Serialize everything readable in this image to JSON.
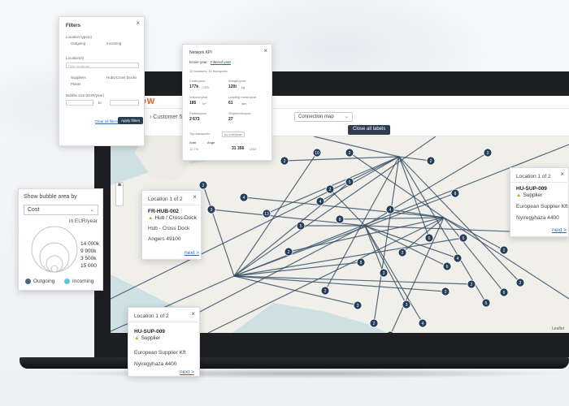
{
  "app": {
    "brand": "OW",
    "breadcrumb": "Customer 5",
    "view_select": "Connection map",
    "close_labels_button": "Close all labels",
    "map_attribution": "Leaflet"
  },
  "filters_panel": {
    "title": "Filters",
    "section_location_types": "Location type(s)",
    "check_outgoing": "Outgoing",
    "check_incoming": "Incoming",
    "locations_label": "Location(s)",
    "locations_placeholder": "Filter locations...",
    "check_suppliers": "Suppliers",
    "check_hubs": "Hubs/Cross Docks",
    "check_plants": "Plants",
    "bubble_size_label": "Bubble size (EUR/year)",
    "range_to": "to",
    "clear_label": "Clear all filters",
    "apply_label": "Apply filters"
  },
  "kpi_panel": {
    "title": "Network KPI",
    "tab_entire": "Entire year",
    "tab_filtered": "Filtered year",
    "summary": "22 locations, 11 transports",
    "cells": [
      {
        "label": "Costs/year",
        "value": "177k",
        "unit": "USD"
      },
      {
        "label": "Weight/year",
        "value": "120t",
        "unit": "kg"
      },
      {
        "label": "Volume/year",
        "value": "185",
        "unit": "m³"
      },
      {
        "label": "Loading meter/year",
        "value": "61",
        "unit": "ldm"
      },
      {
        "label": "Pallets/year",
        "value": "2 673",
        "unit": ""
      },
      {
        "label": "Shipments/year",
        "value": "27",
        "unit": ""
      }
    ],
    "top_label": "Top transports",
    "top_select": "by cost/year",
    "row_from": "Amb",
    "row_to": "Ange",
    "row_pct": "11.7%",
    "row_value": "31 356",
    "row_unit": "USD"
  },
  "bubble_panel": {
    "label": "Show bubble area by",
    "selected": "Cost",
    "unit": "in EUR/year",
    "values": [
      "14 000k",
      "9 900k",
      "3 500k",
      "15 000"
    ],
    "legend_outgoing": "Outgoing",
    "legend_incoming": "Incoming",
    "color_outgoing": "#4a6384",
    "color_incoming": "#5bc8e0"
  },
  "popup_fr": {
    "header": "Location 1 of 2",
    "code": "FR-HUB-002",
    "type": "Hub / Cross-Dock",
    "name": "Hub - Cross Dock",
    "city": "Angers 49100",
    "next": "next >"
  },
  "popup_hu_right": {
    "header": "Location 1 of 2",
    "code": "HU-SUP-009",
    "type": "Supplier",
    "name": "European Supplier Kft",
    "city": "Nyíregyháza 4400",
    "next": "next >"
  },
  "popup_hu_bottom": {
    "header": "Location 1 of 2",
    "code": "HU-SUP-009",
    "type": "Supplier",
    "name": "European Supplier Kft",
    "city": "Nyiregyhaza 4400",
    "next": "next >"
  },
  "map_markers": [
    "2",
    "3",
    "4",
    "2",
    "10",
    "2",
    "8",
    "4",
    "5",
    "5",
    "2",
    "13",
    "8",
    "3",
    "2",
    "6",
    "2",
    "4",
    "6",
    "5",
    "2",
    "4",
    "7",
    "2",
    "3",
    "3",
    "4",
    "2",
    "8",
    "3",
    "2",
    "2",
    "5",
    "6",
    "2",
    "2"
  ]
}
